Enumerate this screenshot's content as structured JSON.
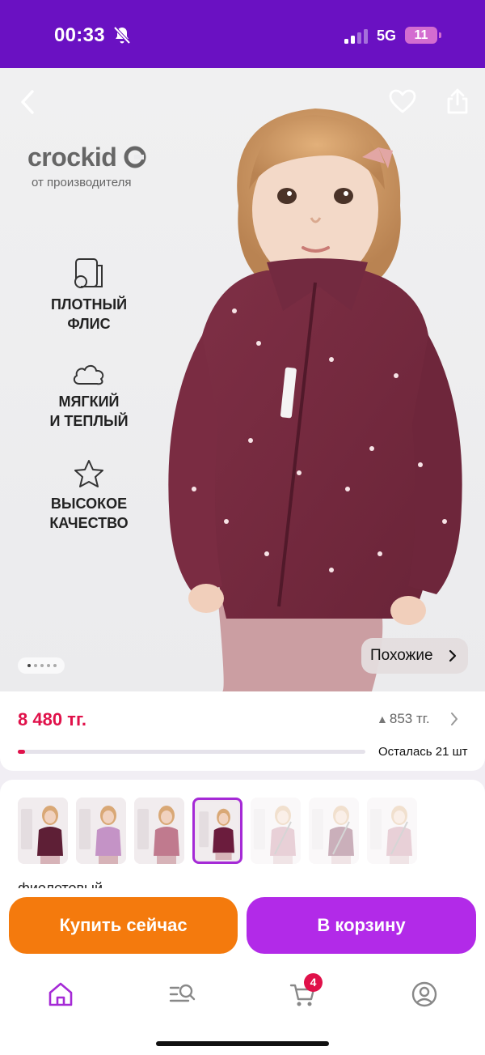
{
  "status_bar": {
    "time": "00:33",
    "network": "5G",
    "battery": "11"
  },
  "hero": {
    "brand": "crockid",
    "brand_sub": "от производителя",
    "features": [
      {
        "icon": "fleece-roll-icon",
        "text": "ПЛОТНЫЙ\nФЛИС"
      },
      {
        "icon": "cloud-icon",
        "text": "МЯГКИЙ\nИ ТЕПЛЫЙ"
      },
      {
        "icon": "star-icon",
        "text": "ВЫСОКОЕ\nКАЧЕСТВО"
      }
    ],
    "zipper_tag": "#CROCKID",
    "similar_label": "Похожие",
    "carousel": {
      "count": 5,
      "active": 1
    }
  },
  "price": {
    "current": "8 480 тг.",
    "difference": "853 тг.",
    "stock_text": "Осталась 21 шт",
    "stock_fraction": 0.02
  },
  "variants": {
    "colors": [
      "#5e1f36",
      "#c493c6",
      "#c07a8e",
      "#6b1c3d",
      "#c07a8e",
      "#6b1c3d",
      "#c07a8e"
    ],
    "selected_index": 3,
    "unavailable": [
      4,
      5,
      6
    ],
    "color_name": "фиолетовый"
  },
  "actions": {
    "buy_now": "Купить сейчас",
    "add_to_cart": "В корзину"
  },
  "nav": {
    "cart_count": "4"
  },
  "colors": {
    "brand_purple": "#6a11c2",
    "accent_red": "#e0114a",
    "buy_orange": "#f47a0d",
    "cart_purple": "#b22ae8"
  }
}
